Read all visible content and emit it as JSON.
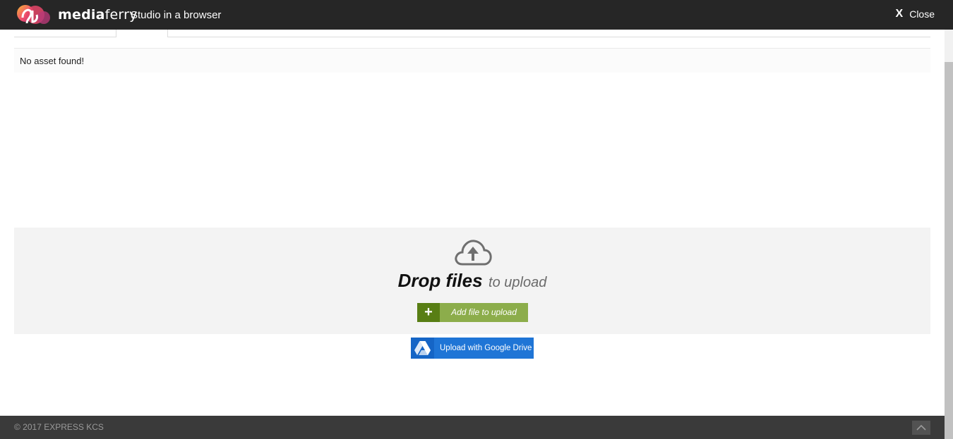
{
  "header": {
    "brand_prefix": "media",
    "brand_suffix": "ferry",
    "tagline": "Studio in a browser",
    "close_icon": "X",
    "close_label": "Close"
  },
  "assets": {
    "empty_message": "No asset found!"
  },
  "upload": {
    "drop_strong": "Drop files",
    "drop_light": "to upload",
    "add_icon": "+",
    "add_label": "Add file to upload",
    "gdrive_label": "Upload with Google Drive",
    "icons": {
      "cloud": "cloud-upload-icon",
      "drive": "google-drive-icon"
    }
  },
  "footer": {
    "copyright": "© 2017 EXPRESS KCS",
    "back_to_top_icon": "chevron-up-icon"
  },
  "colors": {
    "header_bg": "#262626",
    "dropzone_bg": "#f3f3f3",
    "add_button": "#8cad4b",
    "add_button_dark": "#587e14",
    "gdrive_button": "#1f75d6",
    "footer_bg": "#3a3a3a"
  }
}
